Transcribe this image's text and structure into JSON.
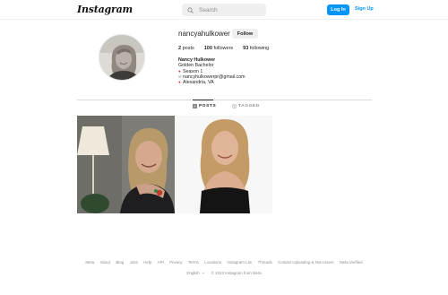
{
  "header": {
    "logo_text": "Instagram",
    "search_placeholder": "Search",
    "search_icon": "search-icon",
    "login_label": "Log In",
    "signup_label": "Sign Up",
    "accent_color": "#0095f6"
  },
  "profile": {
    "username": "nancyahulkower",
    "follow_label": "Follow",
    "stats": {
      "posts_count": "2",
      "posts_label": "posts",
      "followers_count": "100",
      "followers_label": "followers",
      "following_count": "93",
      "following_label": "following"
    },
    "bio": {
      "name": "Nancy Hulkower",
      "line1": "Golden Bachelor",
      "line2": "Season 1",
      "line2_icon": "pin-icon",
      "email": "nancyhulkowerpr@gmail.com",
      "email_icon": "envelope-icon",
      "location": "Alexandria, VA",
      "location_icon": "pin-icon"
    }
  },
  "tabs": [
    {
      "label": "POSTS",
      "icon": "grid-icon",
      "active": true
    },
    {
      "label": "TAGGED",
      "icon": "tag-icon",
      "active": false
    }
  ],
  "posts": [
    {
      "description_icon": "photo-smiling-woman-with-lamp"
    },
    {
      "description_icon": "photo-woman-black-top-white-background"
    }
  ],
  "footer": {
    "links": [
      "Meta",
      "About",
      "Blog",
      "Jobs",
      "Help",
      "API",
      "Privacy",
      "Terms",
      "Locations",
      "Instagram Lite",
      "Threads",
      "Contact Uploading & Non-Users",
      "Meta Verified"
    ],
    "language": "English",
    "copyright": "© 2023 Instagram from Meta"
  }
}
